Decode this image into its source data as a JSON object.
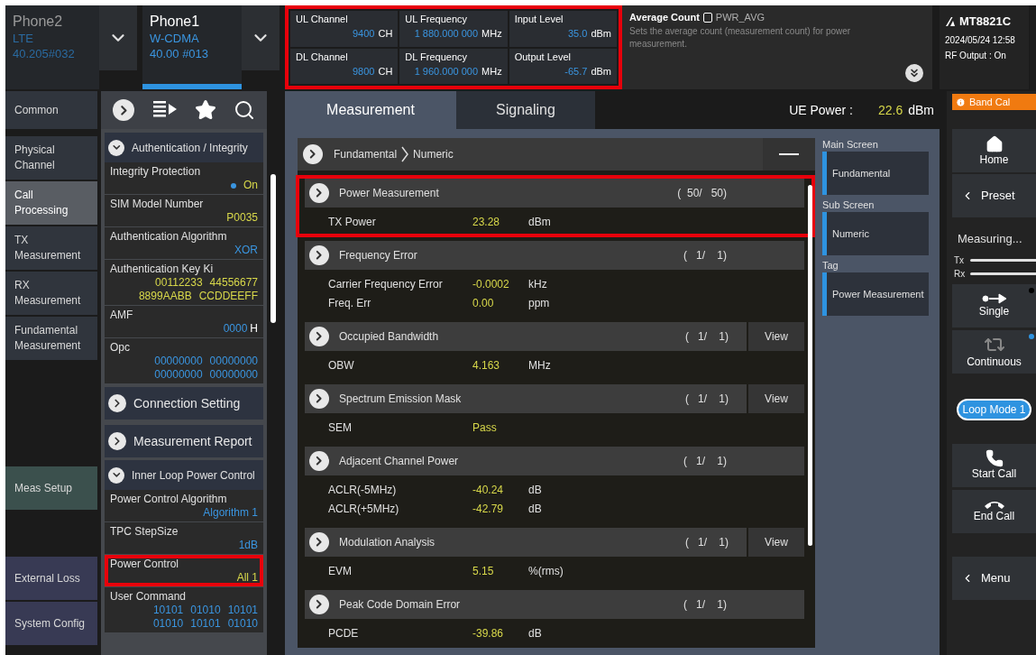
{
  "phone_tabs": [
    {
      "name": "Phone2",
      "system": "LTE",
      "version": "40.205#032",
      "selected": false
    },
    {
      "name": "Phone1",
      "system": "W-CDMA",
      "version": "40.00 #013",
      "selected": true
    }
  ],
  "parameters": {
    "highlighted": true,
    "items": [
      {
        "label": "UL Channel",
        "value": "9400",
        "unit": "CH"
      },
      {
        "label": "UL Frequency",
        "value": "1 880.000 000",
        "unit": "MHz"
      },
      {
        "label": "Input Level",
        "value": "35.0",
        "unit": "dBm"
      },
      {
        "label": "DL Channel",
        "value": "9800",
        "unit": "CH"
      },
      {
        "label": "DL Frequency",
        "value": "1 960.000 000",
        "unit": "MHz"
      },
      {
        "label": "Output Level",
        "value": "-65.7",
        "unit": "dBm"
      }
    ]
  },
  "help": {
    "title": "Average Count",
    "command": "PWR_AVG",
    "text": "Sets the average count (measurement count) for power measurement."
  },
  "instrument": {
    "model": "MT8821C",
    "datetime": "2024/05/24 12:58",
    "rf_output": "RF Output : On"
  },
  "nav_groups": [
    [
      {
        "label": "Common",
        "selected": false,
        "color": "#30353d"
      },
      {
        "label": "Physical Channel",
        "selected": false,
        "color": "#30353d"
      },
      {
        "label": "Call Processing",
        "selected": true,
        "color": "#595d63"
      },
      {
        "label": "TX Measurement",
        "selected": false,
        "color": "#30353d"
      },
      {
        "label": "RX Measurement",
        "selected": false,
        "color": "#30353d"
      },
      {
        "label": "Fundamental Measurement",
        "selected": false,
        "color": "#30353d"
      }
    ],
    [
      {
        "label": "Meas Setup",
        "selected": false,
        "color": "#3b504d"
      }
    ],
    [
      {
        "label": "External Loss",
        "selected": false,
        "color": "#383a54"
      },
      {
        "label": "System Config",
        "selected": false,
        "color": "#383a54"
      }
    ]
  ],
  "settings": [
    {
      "kind": "section",
      "title": "Authentication / Integrity",
      "expanded": true
    },
    {
      "kind": "toggle",
      "label": "Integrity Protection",
      "lines": [
        [
          "On"
        ]
      ],
      "on": true,
      "color": "#d8d84a"
    },
    {
      "kind": "value",
      "label": "SIM Model Number",
      "lines": [
        [
          "P0035"
        ]
      ],
      "color": "#d8d84a"
    },
    {
      "kind": "value",
      "label": "Authentication Algorithm",
      "lines": [
        [
          "XOR"
        ]
      ],
      "color": "#3a95e0"
    },
    {
      "kind": "value",
      "label": "Authentication Key Ki",
      "lines": [
        [
          "00112233",
          "44556677"
        ],
        [
          "8899AABB",
          "CCDDEEFF"
        ]
      ],
      "color": "#d8d84a"
    },
    {
      "kind": "value",
      "label": "AMF",
      "lines": [
        [
          "0000"
        ]
      ],
      "unit": "H",
      "color": "#3a95e0"
    },
    {
      "kind": "value",
      "label": "Opc",
      "lines": [
        [
          "00000000",
          "00000000"
        ],
        [
          "00000000",
          "00000000"
        ]
      ],
      "color": "#3a95e0"
    },
    {
      "kind": "section",
      "title": "Connection Setting",
      "expanded": false
    },
    {
      "kind": "section",
      "title": "Measurement Report",
      "expanded": false
    },
    {
      "kind": "section",
      "title": "Inner Loop Power Control",
      "expanded": true
    },
    {
      "kind": "value",
      "label": "Power Control Algorithm",
      "lines": [
        [
          "Algorithm 1"
        ]
      ],
      "color": "#3a95e0"
    },
    {
      "kind": "value",
      "label": "TPC StepSize",
      "lines": [
        [
          "1dB"
        ]
      ],
      "color": "#3a95e0"
    },
    {
      "kind": "value",
      "label": "Power Control",
      "lines": [
        [
          "All 1"
        ]
      ],
      "color": "#d8d84a",
      "highlighted": true
    },
    {
      "kind": "value",
      "label": "User Command",
      "lines": [
        [
          "10101",
          "01010",
          "10101"
        ],
        [
          "01010",
          "10101",
          "01010"
        ]
      ],
      "color": "#3a95e0"
    }
  ],
  "tabs": [
    {
      "label": "Measurement",
      "selected": true
    },
    {
      "label": "Signaling",
      "selected": false
    }
  ],
  "ue_power": {
    "label": "UE Power :",
    "value": "22.6",
    "unit": "dBm"
  },
  "band_cal": "Band Cal",
  "breadcrumb": [
    "Fundamental",
    "Numeric"
  ],
  "results": [
    {
      "title": "Power Measurement",
      "count": "(  50/   50)",
      "highlighted": true,
      "rows": [
        {
          "label": "TX Power",
          "value": "23.28",
          "unit": "dBm"
        }
      ]
    },
    {
      "title": "Frequency Error",
      "count": "(   1/    1)",
      "rows": [
        {
          "label": "Carrier Frequency Error",
          "value": "-0.0002",
          "unit": "kHz"
        },
        {
          "label": "Freq. Err",
          "value": "0.00",
          "unit": "ppm"
        }
      ]
    },
    {
      "title": "Occupied Bandwidth",
      "count": "(   1/    1)",
      "view": "View",
      "rows": [
        {
          "label": "OBW",
          "value": "4.163",
          "unit": "MHz"
        }
      ]
    },
    {
      "title": "Spectrum Emission Mask",
      "count": "(   1/    1)",
      "view": "View",
      "rows": [
        {
          "label": "SEM",
          "value": "Pass"
        }
      ]
    },
    {
      "title": "Adjacent Channel Power",
      "count": "(   1/    1)",
      "rows": [
        {
          "label": "ACLR(-5MHz)",
          "value": "-40.24",
          "unit": "dB"
        },
        {
          "label": "ACLR(+5MHz)",
          "value": "-42.79",
          "unit": "dB"
        }
      ]
    },
    {
      "title": "Modulation Analysis",
      "count": "(   1/    1)",
      "view": "View",
      "rows": [
        {
          "label": "EVM",
          "value": "5.15",
          "unit": "%(rms)"
        }
      ]
    },
    {
      "title": "Peak Code Domain Error",
      "count": "(   1/    1)",
      "rows": [
        {
          "label": "PCDE",
          "value": "-39.86",
          "unit": "dB"
        }
      ]
    }
  ],
  "screens": [
    {
      "heading": "Main Screen",
      "value": "Fundamental"
    },
    {
      "heading": "Sub Screen",
      "value": "Numeric"
    },
    {
      "heading": "Tag",
      "value": "Power Measurement"
    }
  ],
  "controls": [
    {
      "kind": "home",
      "label": "Home"
    },
    {
      "kind": "preset",
      "label": "Preset"
    },
    {
      "kind": "status",
      "label": "Measuring...",
      "tx": "Tx",
      "rx": "Rx"
    },
    {
      "kind": "single",
      "label": "Single",
      "active": false
    },
    {
      "kind": "continuous",
      "label": "Continuous",
      "active": true
    },
    {
      "kind": "loop",
      "label": "Loop Mode 1"
    },
    {
      "kind": "start_call",
      "label": "Start Call"
    },
    {
      "kind": "end_call",
      "label": "End Call"
    },
    {
      "kind": "menu",
      "label": "Menu"
    }
  ]
}
